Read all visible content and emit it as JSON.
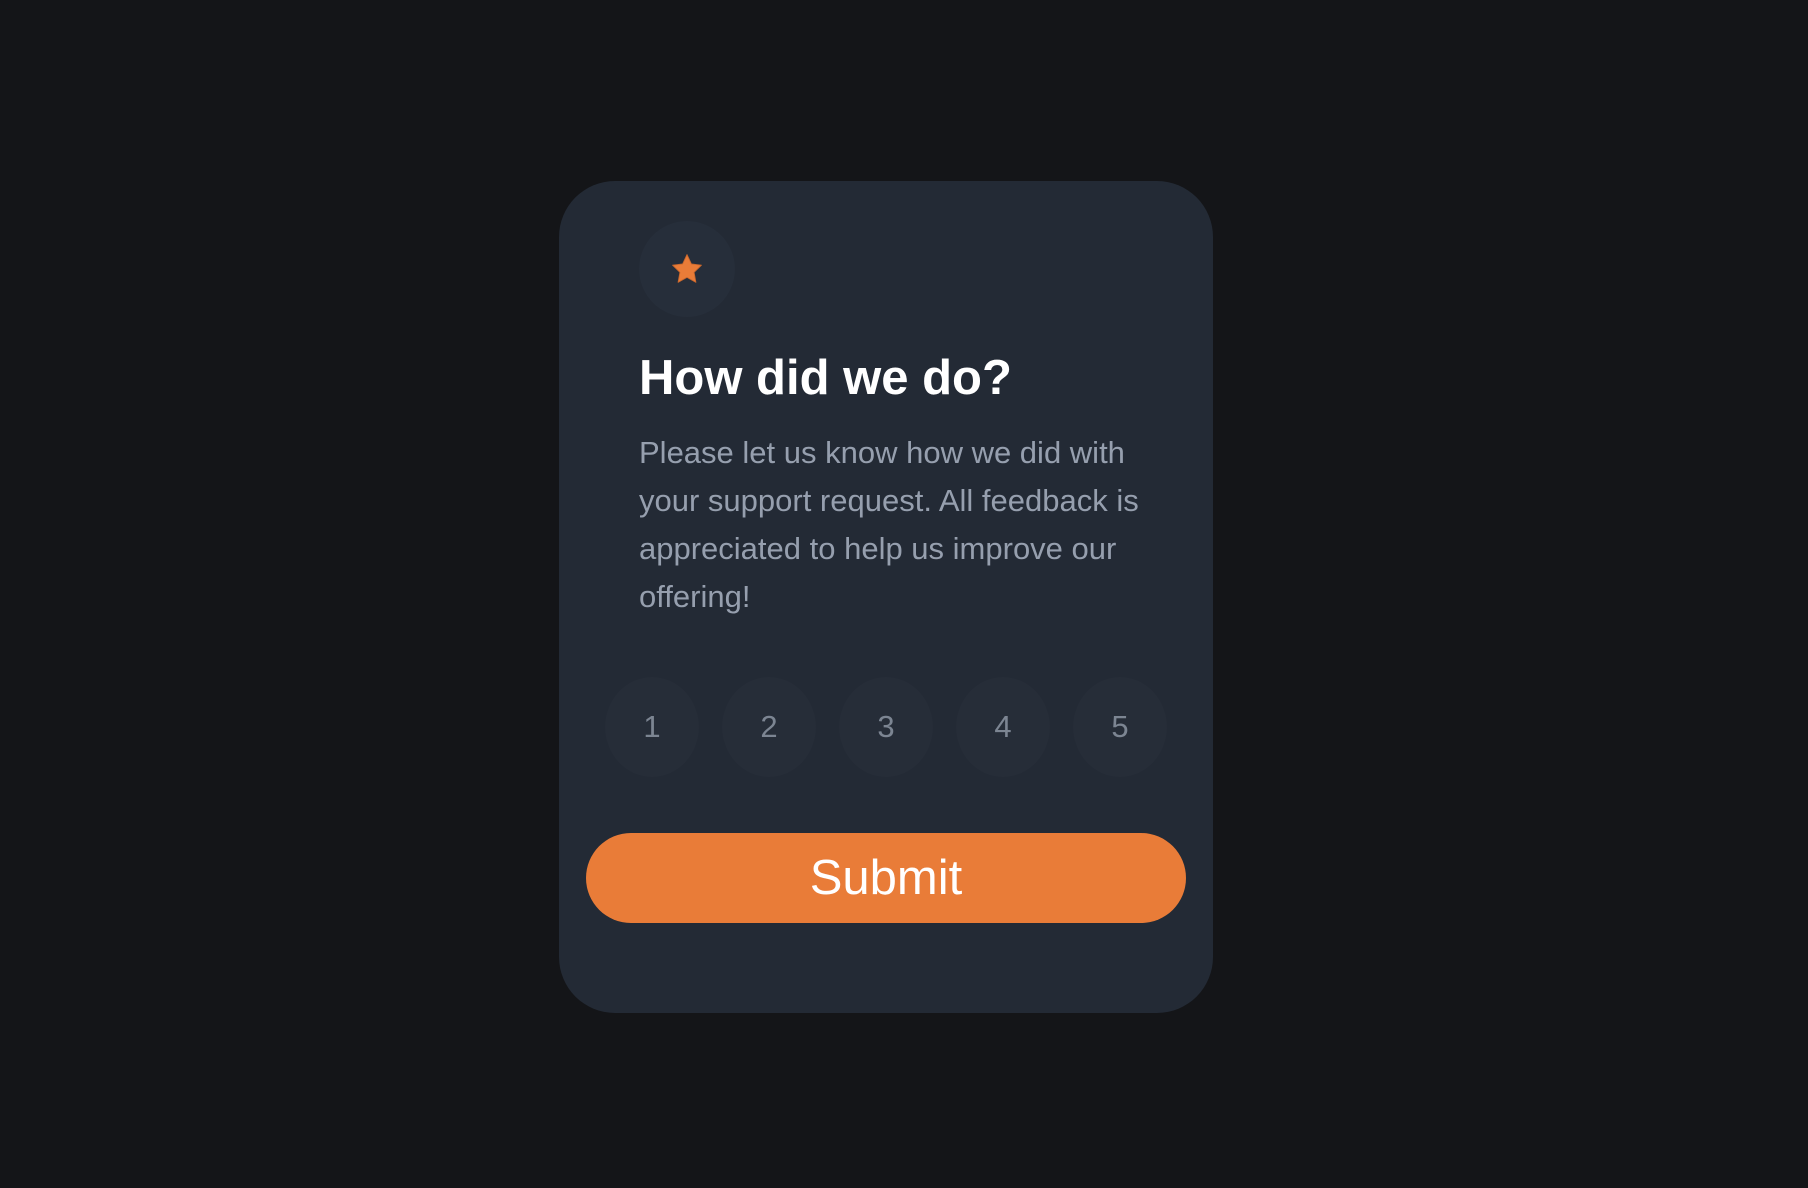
{
  "icons": {
    "badge": "star-icon"
  },
  "colors": {
    "page_background": "#141518",
    "card_background": "#232a35",
    "accent": "#e97c38",
    "title": "#ffffff",
    "body_text": "#969fae",
    "rating_text": "#7c8592"
  },
  "card": {
    "title": "How did we do?",
    "description": "Please let us know how we did with your support request. All feedback is appreciated to help us improve our offering!",
    "ratings": [
      "1",
      "2",
      "3",
      "4",
      "5"
    ],
    "submit_label": "Submit"
  }
}
